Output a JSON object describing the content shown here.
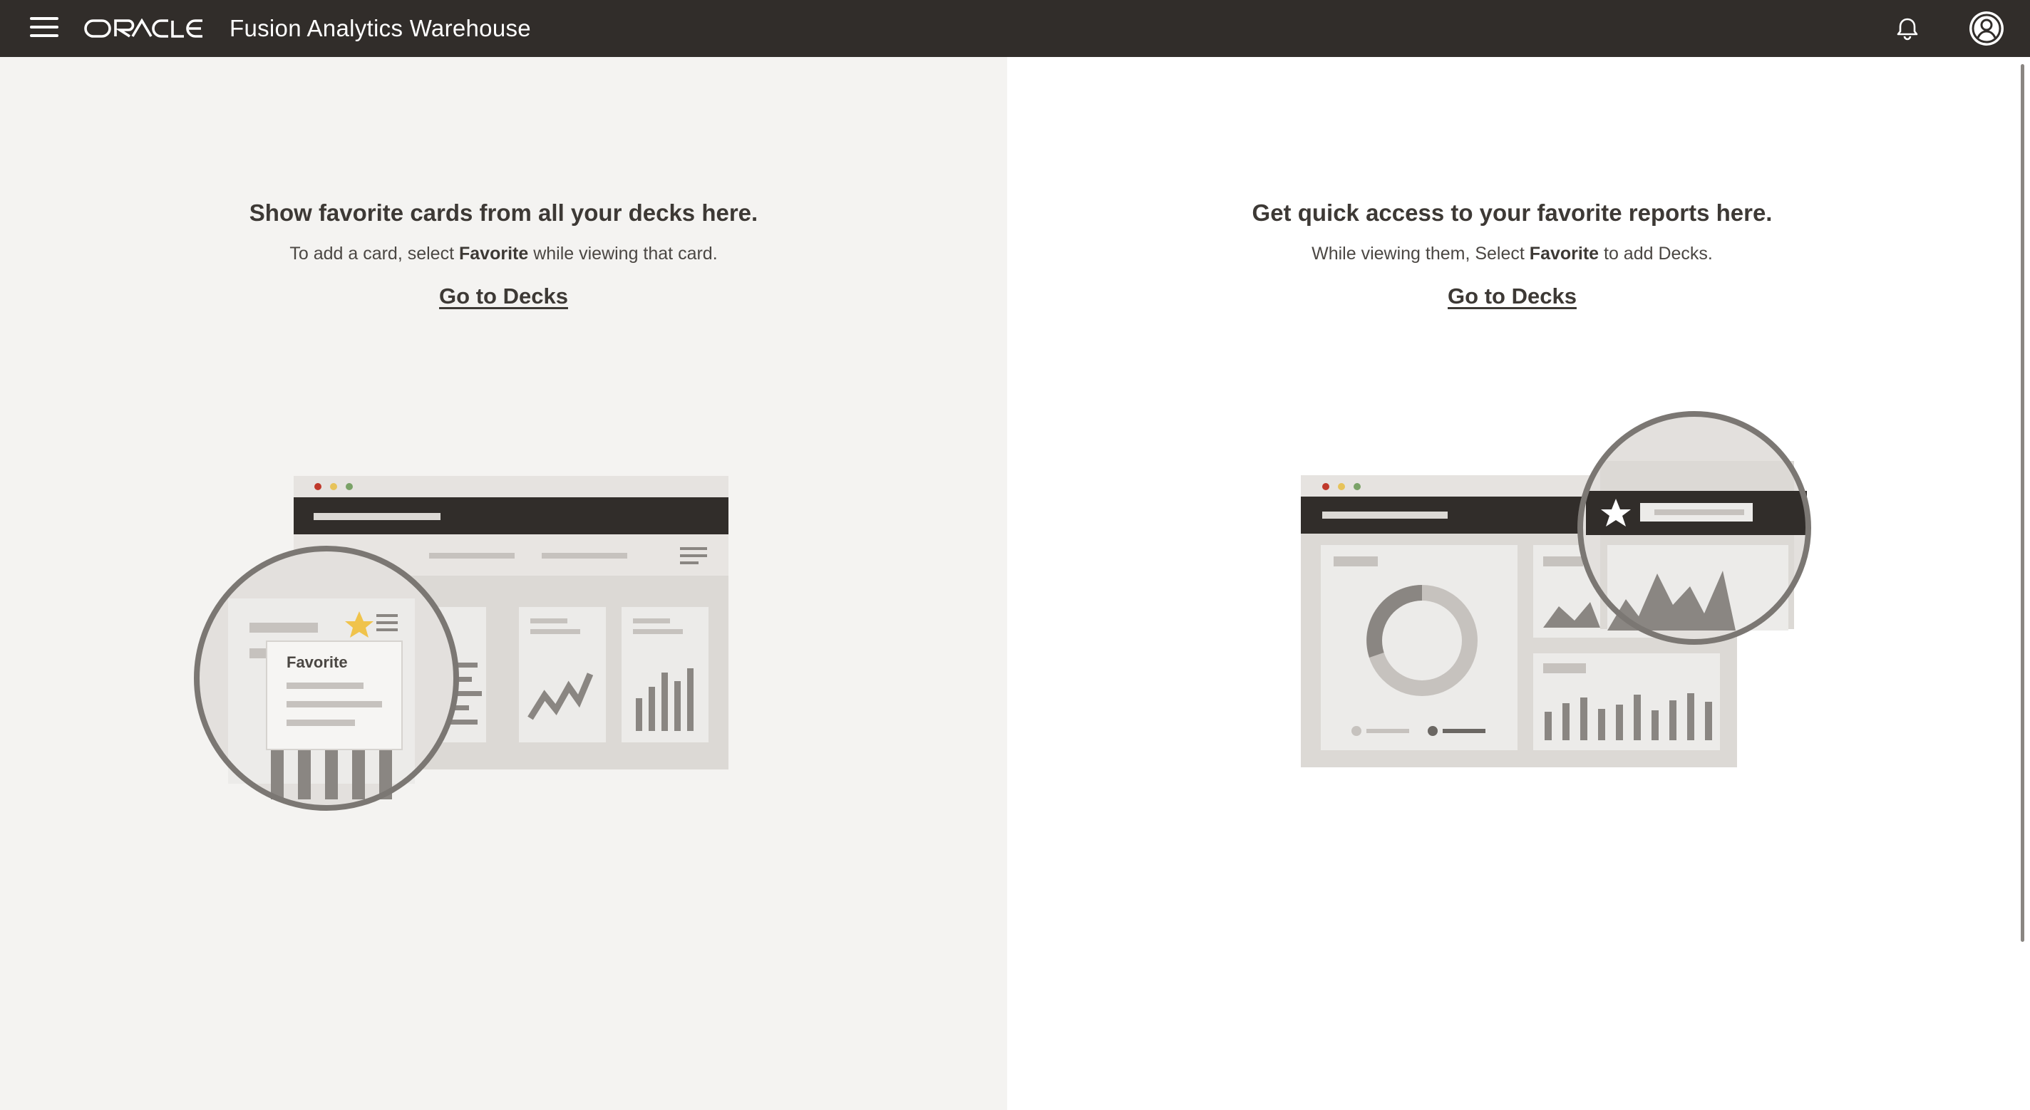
{
  "header": {
    "menu_icon": "hamburger-menu-icon",
    "brand_logo": "ORACLE",
    "app_title": "Fusion Analytics Warehouse",
    "notifications_icon": "bell-icon",
    "user_icon": "user-avatar-icon"
  },
  "left_panel": {
    "heading": "Show favorite cards from all your decks here.",
    "subtext_before": "To add a card, select ",
    "subtext_bold": "Favorite",
    "subtext_after": " while viewing that card.",
    "link_label": "Go to Decks",
    "illustration_menu_label": "Favorite"
  },
  "right_panel": {
    "heading": "Get quick access to your favorite reports here.",
    "subtext_before": "While viewing them, Select ",
    "subtext_bold": "Favorite",
    "subtext_after": " to add Decks.",
    "link_label": "Go to Decks"
  },
  "colors": {
    "header_bg": "#312d2a",
    "left_panel_bg": "#f4f3f1",
    "right_panel_bg": "#ffffff",
    "star_accent": "#f0c34b"
  }
}
